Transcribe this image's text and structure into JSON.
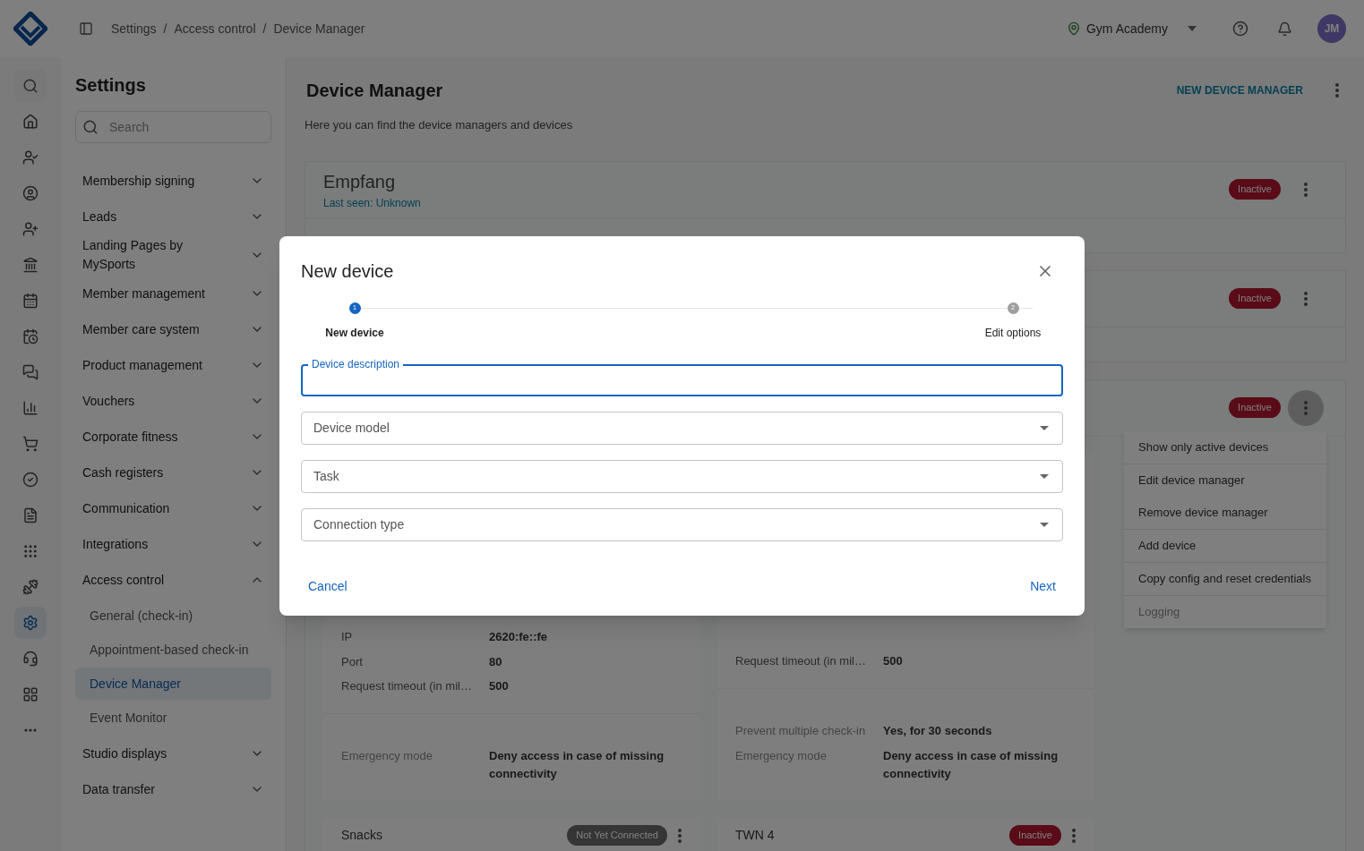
{
  "header": {
    "breadcrumbs": [
      "Settings",
      "Access control",
      "Device Manager"
    ],
    "separators": [
      "/",
      "/"
    ],
    "location": "Gym Academy",
    "avatar": "JM"
  },
  "rail": [
    {
      "selected": false
    },
    {
      "selected": false
    },
    {
      "selected": false
    },
    {
      "selected": false
    },
    {
      "selected": false
    },
    {
      "selected": false
    },
    {
      "selected": false
    },
    {
      "selected": false
    },
    {
      "selected": false
    },
    {
      "selected": false
    },
    {
      "selected": false
    },
    {
      "selected": false
    },
    {
      "selected": false
    },
    {
      "selected": false
    },
    {
      "selected": false
    },
    {
      "selected": true
    },
    {
      "selected": false
    },
    {
      "selected": false
    },
    {
      "selected": false
    }
  ],
  "sidebar": {
    "title": "Settings",
    "search_placeholder": "Search",
    "items": [
      {
        "label": "Membership signing",
        "expanded": false
      },
      {
        "label": "Leads",
        "expanded": false
      },
      {
        "label": "Landing Pages by MySports",
        "expanded": false
      },
      {
        "label": "Member management",
        "expanded": false
      },
      {
        "label": "Member care system",
        "expanded": false
      },
      {
        "label": "Product management",
        "expanded": false
      },
      {
        "label": "Vouchers",
        "expanded": false
      },
      {
        "label": "Corporate fitness",
        "expanded": false
      },
      {
        "label": "Cash registers",
        "expanded": false
      },
      {
        "label": "Communication",
        "expanded": false
      },
      {
        "label": "Integrations",
        "expanded": false
      },
      {
        "label": "Access control",
        "expanded": true,
        "children": [
          {
            "label": "General (check-in)",
            "selected": false
          },
          {
            "label": "Appointment-based check-in",
            "selected": false
          },
          {
            "label": "Device Manager",
            "selected": true
          },
          {
            "label": "Event Monitor",
            "selected": false
          }
        ]
      },
      {
        "label": "Studio displays",
        "expanded": false
      },
      {
        "label": "Data transfer",
        "expanded": false
      }
    ]
  },
  "main": {
    "title": "Device Manager",
    "subtitle": "Here you can find the device managers and devices",
    "action": "NEW DEVICE MANAGER"
  },
  "managers": [
    {
      "name": "Empfang",
      "last_seen": "Last seen: Unknown",
      "status": "Inactive",
      "menu_open": false
    },
    {
      "status": "Inactive",
      "menu_open": false
    },
    {
      "status": "Inactive",
      "menu_open": true,
      "menu": [
        [
          {
            "label": "Show only active devices",
            "disabled": false
          }
        ],
        [
          {
            "label": "Edit device manager",
            "disabled": false
          },
          {
            "label": "Remove device manager",
            "disabled": false
          }
        ],
        [
          {
            "label": "Add device",
            "disabled": false
          }
        ],
        [
          {
            "label": "Copy config and reset credentials",
            "disabled": false
          }
        ],
        [
          {
            "label": "Logging",
            "disabled": true
          }
        ]
      ],
      "devices": [
        {
          "kind": "details",
          "rows": [
            {
              "label": "IP",
              "value": "2620:fe::fe"
            },
            {
              "label": "Port",
              "value": "80"
            },
            {
              "label": "Request timeout (in mil…",
              "value": "500"
            }
          ],
          "settings": [
            {
              "label": "Emergency mode",
              "value": "Deny access in case of missing connectivity"
            }
          ]
        },
        {
          "kind": "details",
          "rows": [
            {
              "label": "Request timeout (in mil…",
              "value": "500"
            }
          ],
          "settings": [
            {
              "label": "Prevent multiple check-in",
              "value": "Yes, for 30 seconds"
            },
            {
              "label": "Emergency mode",
              "value": "Deny access in case of missing connectivity"
            }
          ]
        },
        {
          "kind": "summary",
          "name": "Snacks",
          "status": "Not Yet Connected",
          "pending": true
        },
        {
          "kind": "summary",
          "name": "TWN 4",
          "status": "Inactive",
          "pending": false
        }
      ]
    }
  ],
  "modal": {
    "title": "New device",
    "steps": [
      {
        "number": "1",
        "label": "New device",
        "selected": true
      },
      {
        "number": "2",
        "label": "Edit options",
        "selected": false
      }
    ],
    "fields": [
      {
        "kind": "text",
        "label": "Device description",
        "focused": true
      },
      {
        "kind": "select",
        "placeholder": "Device model"
      },
      {
        "kind": "select",
        "placeholder": "Task"
      },
      {
        "kind": "select",
        "placeholder": "Connection type"
      }
    ],
    "cancel": "Cancel",
    "next": "Next"
  }
}
